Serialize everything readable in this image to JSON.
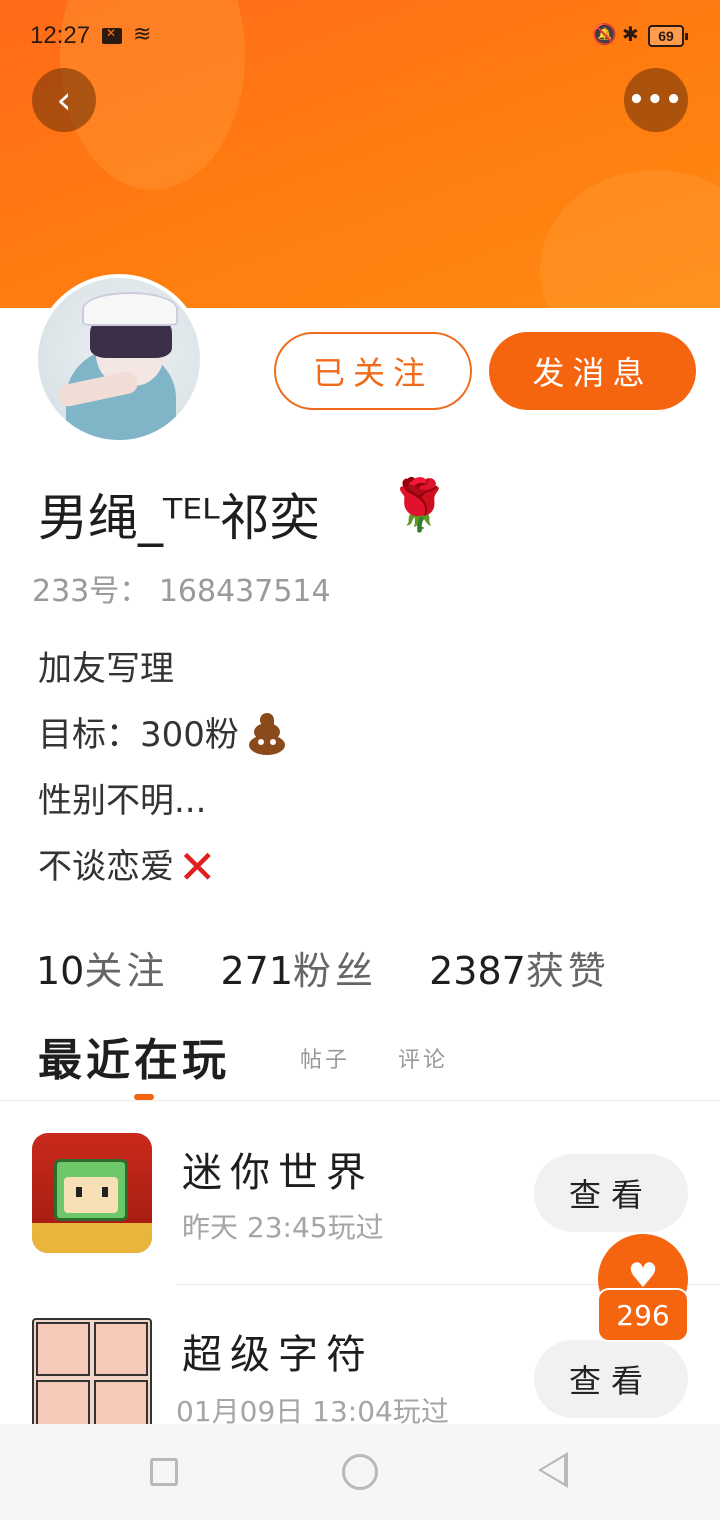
{
  "status_bar": {
    "time": "12:27",
    "battery": "69"
  },
  "profile": {
    "follow_label": "已关注",
    "message_label": "发消息",
    "name": "男绳_ᵀᴱᴸ祁奕",
    "uid_label": "233号：",
    "uid_value": "168437514",
    "bio": [
      "加友写理",
      "目标：300粉",
      "性别不明...",
      "不谈恋爱"
    ]
  },
  "stats": {
    "following_count": "10",
    "following_label": "关注",
    "fans_count": "271",
    "fans_label": "粉丝",
    "likes_count": "2387",
    "likes_label": "获赞"
  },
  "tabs": {
    "active": "最近在玩",
    "posts": "帖子",
    "comments": "评论"
  },
  "games": [
    {
      "title": "迷你世界",
      "time": "昨天 23:45玩过",
      "button": "查看"
    },
    {
      "title": "超级字符",
      "time": "01月09日 13:04玩过",
      "button": "查看"
    }
  ],
  "like_fab": {
    "count": "296"
  },
  "icons": {
    "back": "chevron-left-icon",
    "more": "more-dots-icon",
    "rose": "rose-emoji",
    "poop": "poop-emoji",
    "cross": "cross-mark-emoji",
    "heart": "heart-icon"
  },
  "colors": {
    "accent": "#f56510",
    "banner": "#ff7a10"
  }
}
